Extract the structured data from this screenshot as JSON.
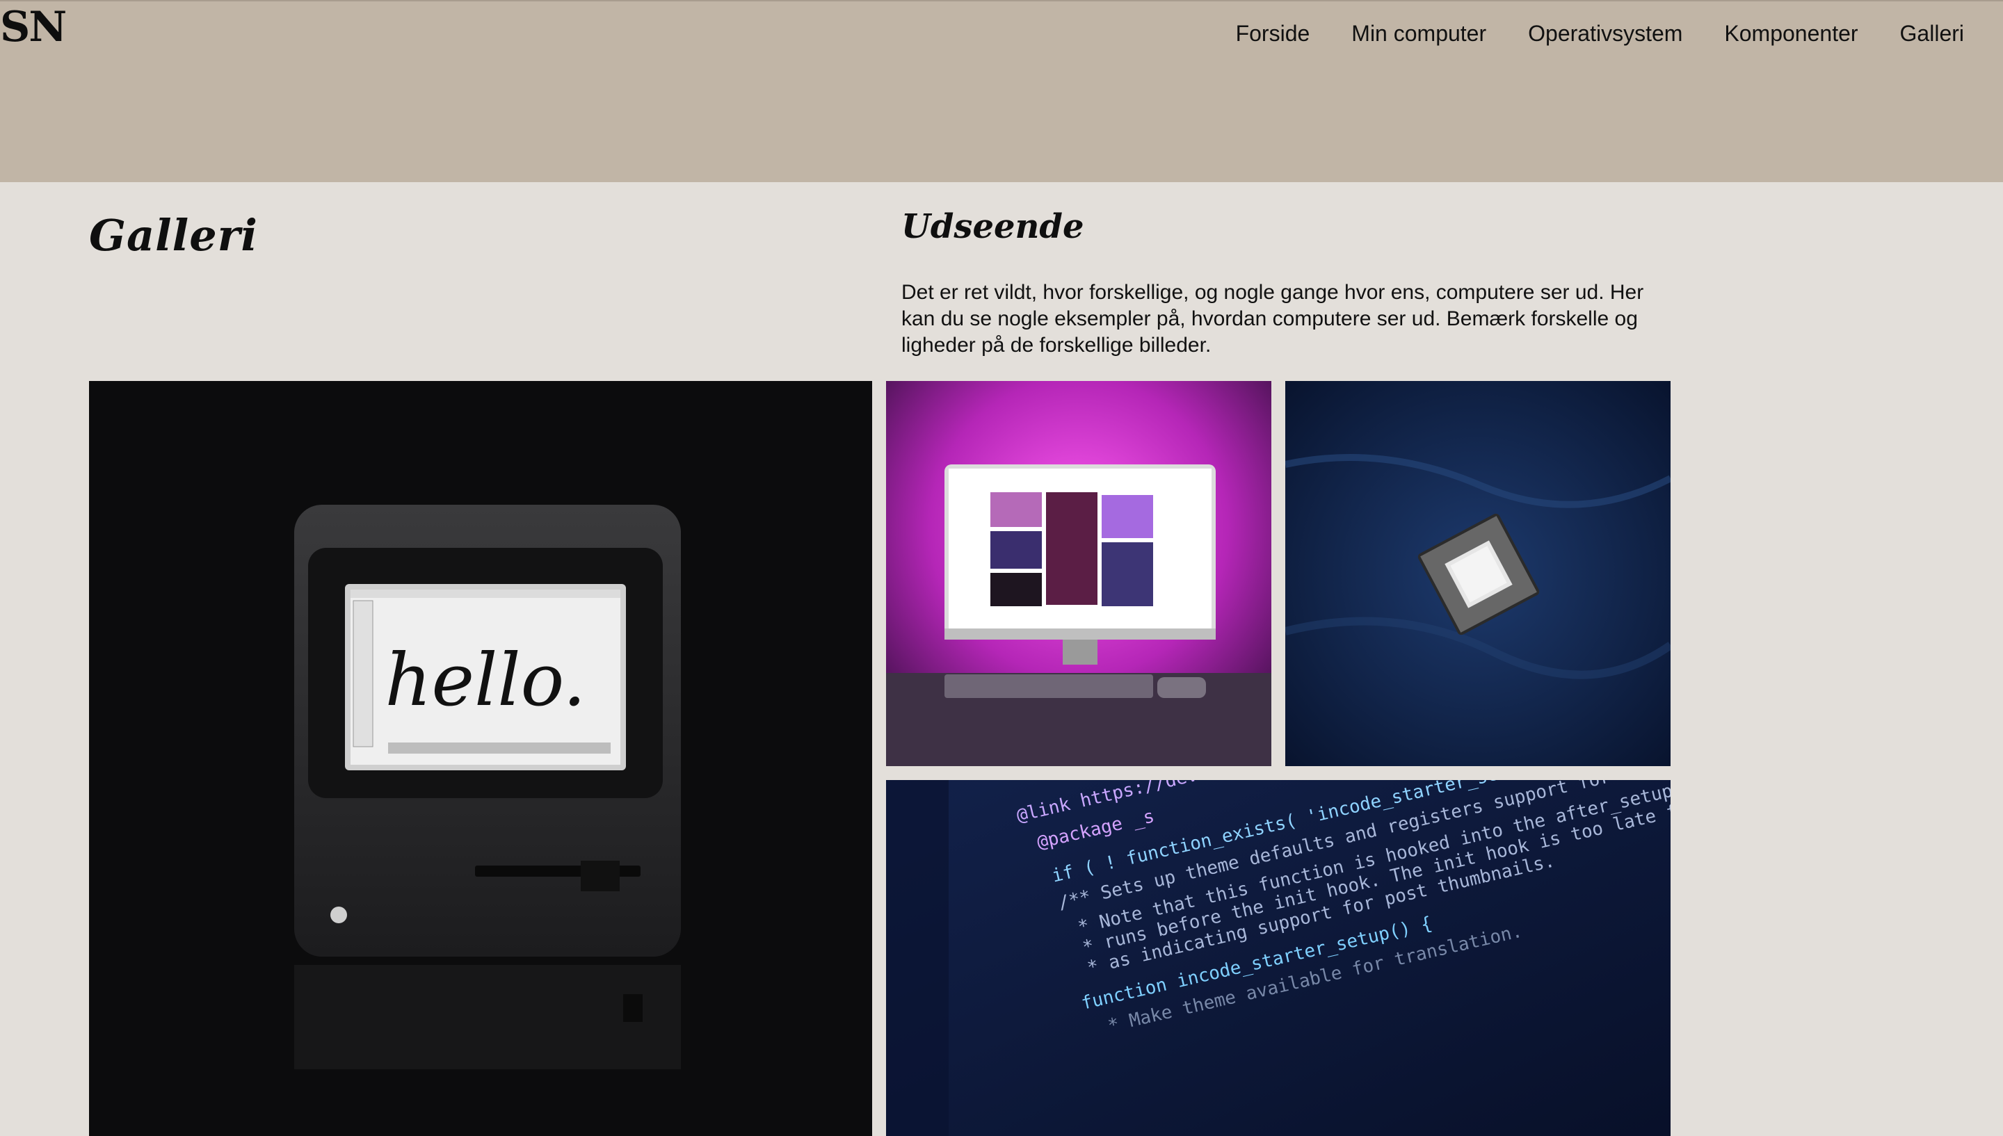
{
  "header": {
    "logo": "SN",
    "nav": [
      "Forside",
      "Min computer",
      "Operativsystem",
      "Komponenter",
      "Galleri"
    ]
  },
  "page": {
    "title": "Galleri",
    "section_title": "Udseende",
    "intro": "Det er ret vildt, hvor forskellige, og nogle gange hvor ens, computere ser ud. Her kan du se nogle eksempler på, hvordan computere ser ud. Bemærk forskelle og ligheder på de forskellige billeder."
  },
  "gallery": {
    "mac_screen_text": "hello.",
    "code_lines": [
      "@link https://deve",
      "@package _s",
      "if ( ! function_exists( 'incode_starter_setup' ) ) :",
      "/** Sets up theme defaults and registers support for various WordPress features.",
      "* Note that this function is hooked into the after_setup_theme hook, which",
      "* runs before the init hook. The init hook is too late for some features, such",
      "* as indicating support for post thumbnails.",
      "function incode_starter_setup() {",
      "* Make theme available for translation."
    ]
  },
  "colors": {
    "header_bg": "#c1b5a6",
    "page_bg": "#e3dfda",
    "accent_magenta": "#d42fd8",
    "cpu_bg": "#0e1a3a",
    "code_bg": "#0b1530"
  }
}
